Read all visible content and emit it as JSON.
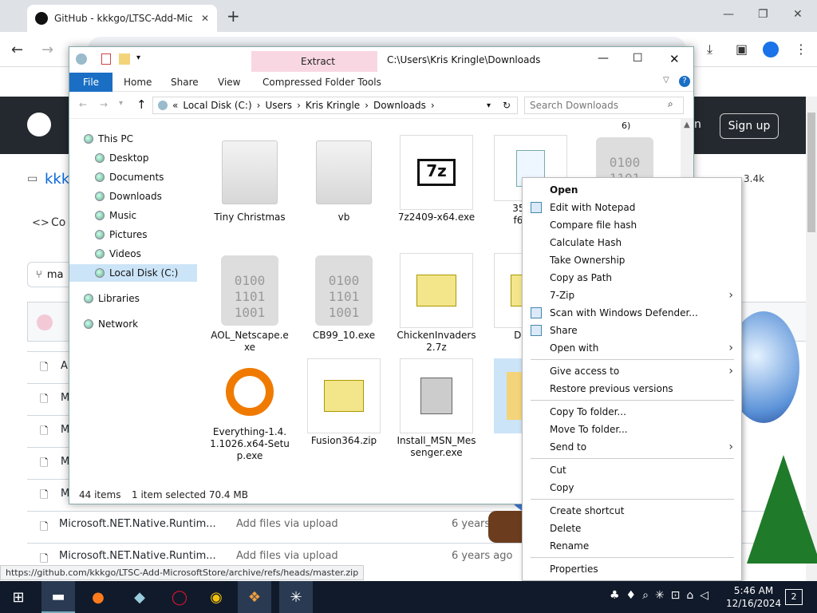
{
  "browser": {
    "tab_title": "GitHub - kkkgo/LTSC-Add-Mic",
    "new_tab": "+",
    "status_url": "https://github.com/kkkgo/LTSC-Add-MicrosoftStore/archive/refs/heads/master.zip",
    "sign_up": "Sign up",
    "sign_in_partial": "n",
    "star_count": "3.4k",
    "repo_partial": "kkk",
    "code_tab_partial": "Co",
    "branch_partial": "ma",
    "rows": [
      {
        "name": "Microsoft.NET.Native.Runtim...",
        "msg": "Add files via upload",
        "age": "6 years ago"
      },
      {
        "name": "Microsoft.NET.Native.Runtim...",
        "msg": "Add files via upload",
        "age": "6 years ago"
      }
    ],
    "left_rows": [
      "A",
      "M",
      "M",
      "M",
      "M"
    ]
  },
  "explorer": {
    "title_path": "C:\\Users\\Kris Kringle\\Downloads",
    "extract_label": "Extract",
    "ribbon_tabs": [
      "File",
      "Home",
      "Share",
      "View",
      "Compressed Folder Tools"
    ],
    "breadcrumb": [
      "«",
      "Local Disk (C:)",
      "Users",
      "Kris Kringle",
      "Downloads"
    ],
    "search_placeholder": "Search Downloads",
    "nav": [
      "This PC",
      "Desktop",
      "Documents",
      "Downloads",
      "Music",
      "Pictures",
      "Videos",
      "Local Disk (C:)",
      "Libraries",
      "Network"
    ],
    "files": [
      {
        "name": "Tiny Christmas",
        "kind": "folder"
      },
      {
        "name": "vb",
        "kind": "folder"
      },
      {
        "name": "7z2409-x64.exe",
        "kind": "7z"
      },
      {
        "name": "3593e4\nf639ff0\n5",
        "kind": "doc"
      },
      {
        "name": "",
        "kind": "bin"
      },
      {
        "name": "AOL_Netscape.exe",
        "kind": "bin"
      },
      {
        "name": "CB99_10.exe",
        "kind": "bin"
      },
      {
        "name": "ChickenInvaders2.7z",
        "kind": "zip7"
      },
      {
        "name": "Deskto\n_",
        "kind": "zip7"
      },
      {
        "name": "Everything-1.4.1.1026.x64-Setup.exe",
        "kind": "search"
      },
      {
        "name": "Fusion364.zip",
        "kind": "zip"
      },
      {
        "name": "Install_MSN_Messenger.exe",
        "kind": "setup"
      },
      {
        "name": "",
        "kind": "folder-sel"
      }
    ],
    "extra_label": "6)",
    "status_items": "44 items",
    "status_selected": "1 item selected  70.4 MB"
  },
  "context_menu": [
    {
      "label": "Open",
      "bold": true
    },
    {
      "label": "Edit with Notepad",
      "icon": "notepad-icon"
    },
    {
      "label": "Compare file hash"
    },
    {
      "label": "Calculate Hash"
    },
    {
      "label": "Take Ownership"
    },
    {
      "label": "Copy as Path"
    },
    {
      "label": "7-Zip",
      "sub": true
    },
    {
      "label": "Scan with Windows Defender...",
      "icon": "defender-icon"
    },
    {
      "label": "Share",
      "icon": "share-icon"
    },
    {
      "label": "Open with",
      "sub": true
    },
    {
      "sep": true
    },
    {
      "label": "Give access to",
      "sub": true
    },
    {
      "label": "Restore previous versions"
    },
    {
      "sep": true
    },
    {
      "label": "Copy To folder..."
    },
    {
      "label": "Move To folder..."
    },
    {
      "label": "Send to",
      "sub": true
    },
    {
      "sep": true
    },
    {
      "label": "Cut"
    },
    {
      "label": "Copy"
    },
    {
      "sep": true
    },
    {
      "label": "Create shortcut"
    },
    {
      "label": "Delete"
    },
    {
      "label": "Rename"
    },
    {
      "sep": true
    },
    {
      "label": "Properties"
    }
  ],
  "taskbar": {
    "time": "5:46 AM",
    "date": "12/16/2024",
    "notif_count": "2"
  }
}
